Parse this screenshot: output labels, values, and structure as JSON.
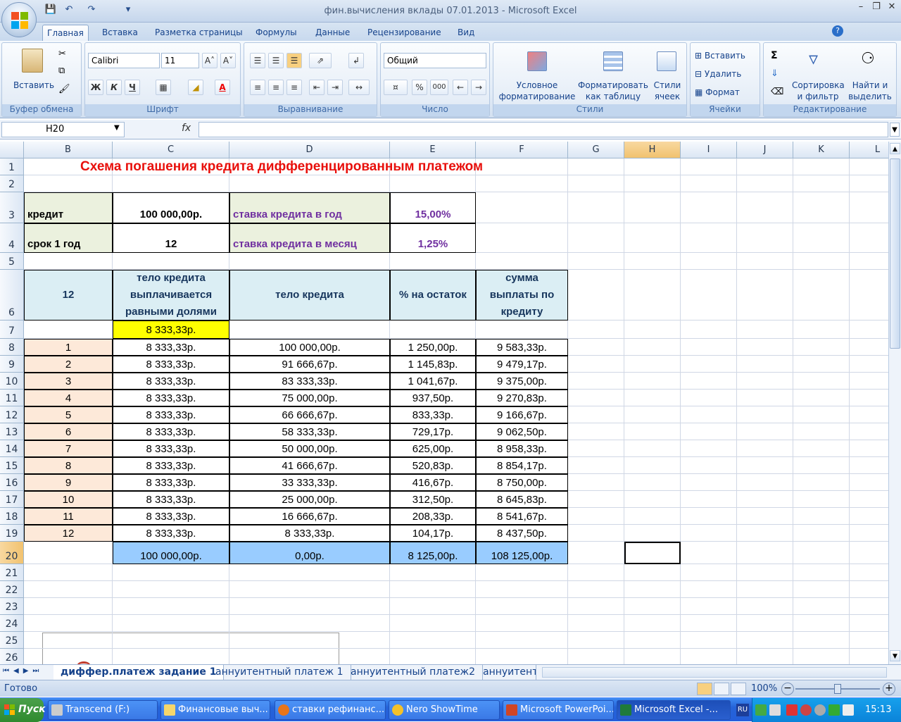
{
  "window": {
    "title": "фин.вычисления вклады 07.01.2013 - Microsoft Excel",
    "qat_icons": [
      "save-icon",
      "undo-icon",
      "redo-icon",
      "customize-icon"
    ]
  },
  "tabs": [
    "Главная",
    "Вставка",
    "Разметка страницы",
    "Формулы",
    "Данные",
    "Рецензирование",
    "Вид"
  ],
  "ribbon": {
    "clipboard": {
      "label": "Буфер обмена",
      "paste": "Вставить"
    },
    "font": {
      "label": "Шрифт",
      "name": "Calibri",
      "size": "11",
      "bold": "Ж",
      "italic": "К",
      "underline": "Ч"
    },
    "alignment": {
      "label": "Выравнивание"
    },
    "number": {
      "label": "Число",
      "format": "Общий",
      "percent": "%",
      "thousands": "000"
    },
    "styles": {
      "label": "Стили",
      "conditional": "Условное форматирование",
      "as_table": "Форматировать как таблицу",
      "cell_styles": "Стили ячеек"
    },
    "cells": {
      "label": "Ячейки",
      "insert": "Вставить",
      "delete": "Удалить",
      "format": "Формат"
    },
    "editing": {
      "label": "Редактирование",
      "sort": "Сортировка и фильтр",
      "find": "Найти и выделить"
    }
  },
  "formula_bar": {
    "name_box": "H20",
    "fx": "fx",
    "formula": ""
  },
  "columns": [
    "B",
    "C",
    "D",
    "E",
    "F",
    "G",
    "H",
    "I",
    "J",
    "K",
    "L"
  ],
  "rows": [
    "1",
    "2",
    "3",
    "4",
    "5",
    "6",
    "7",
    "8",
    "9",
    "10",
    "11",
    "12",
    "13",
    "14",
    "15",
    "16",
    "17",
    "18",
    "19",
    "20",
    "21",
    "22",
    "23",
    "24",
    "25",
    "26"
  ],
  "sheet": {
    "title": "Схема погашения кредита дифференцированным платежом",
    "credit_label": "кредит",
    "credit_value": "100 000,00р.",
    "term_label": "срок 1 год",
    "term_value": "12",
    "rate_year_label": "ставка кредита в год",
    "rate_year_value": "15,00%",
    "rate_month_label": "ставка кредита в месяц",
    "rate_month_value": "1,25%",
    "header": [
      "12",
      "тело кредита выплачивается равными долями",
      "тело кредита",
      "% на остаток",
      "сумма выплаты по кредиту"
    ],
    "row7_value": "8 333,33р.",
    "data": [
      [
        "1",
        "8 333,33р.",
        "100 000,00р.",
        "1 250,00р.",
        "9 583,33р."
      ],
      [
        "2",
        "8 333,33р.",
        "91 666,67р.",
        "1 145,83р.",
        "9 479,17р."
      ],
      [
        "3",
        "8 333,33р.",
        "83 333,33р.",
        "1 041,67р.",
        "9 375,00р."
      ],
      [
        "4",
        "8 333,33р.",
        "75 000,00р.",
        "937,50р.",
        "9 270,83р."
      ],
      [
        "5",
        "8 333,33р.",
        "66 666,67р.",
        "833,33р.",
        "9 166,67р."
      ],
      [
        "6",
        "8 333,33р.",
        "58 333,33р.",
        "729,17р.",
        "9 062,50р."
      ],
      [
        "7",
        "8 333,33р.",
        "50 000,00р.",
        "625,00р.",
        "8 958,33р."
      ],
      [
        "8",
        "8 333,33р.",
        "41 666,67р.",
        "520,83р.",
        "8 854,17р."
      ],
      [
        "9",
        "8 333,33р.",
        "33 333,33р.",
        "416,67р.",
        "8 750,00р."
      ],
      [
        "10",
        "8 333,33р.",
        "25 000,00р.",
        "312,50р.",
        "8 645,83р."
      ],
      [
        "11",
        "8 333,33р.",
        "16 666,67р.",
        "208,33р.",
        "8 541,67р."
      ],
      [
        "12",
        "8 333,33р.",
        "8 333,33р.",
        "104,17р.",
        "8 437,50р."
      ]
    ],
    "totals": [
      "100 000,00р.",
      "0,00р.",
      "8 125,00р.",
      "108 125,00р."
    ]
  },
  "sheet_tabs": [
    "диффер.платеж задание 1",
    "аннуитентный платеж 1",
    "аннуитентный платеж2",
    "аннуитент"
  ],
  "status": {
    "ready": "Готово",
    "zoom": "100%"
  },
  "taskbar": {
    "start": "Пуск",
    "items": [
      "Transcend (F:)",
      "Финансовые выч...",
      "ставки рефинанс...",
      "Nero ShowTime",
      "Microsoft PowerPoi...",
      "Microsoft Excel -..."
    ],
    "lang": "RU",
    "clock": "15:13"
  },
  "colors": {
    "title_red": "#e8100c",
    "label_bg": "#ebf1de",
    "purple": "#7030a0",
    "header_bg": "#dbeef4",
    "peach": "#fde9d9",
    "yellow": "#ffff00",
    "total_blue": "#99ccff"
  }
}
